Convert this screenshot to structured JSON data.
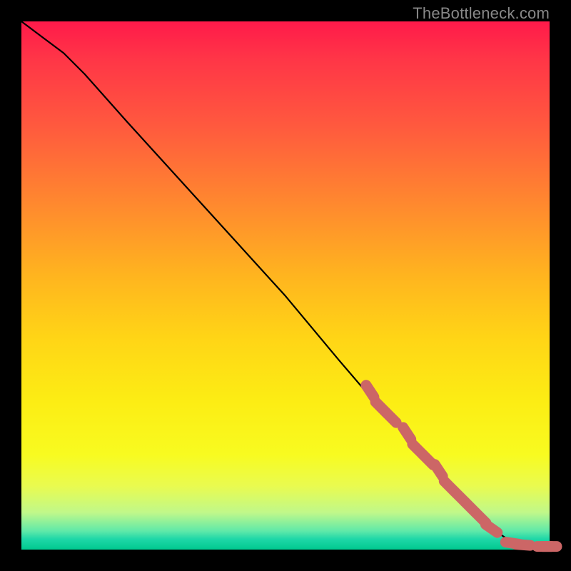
{
  "watermark": "TheBottleneck.com",
  "chart_data": {
    "type": "line",
    "title": "",
    "xlabel": "",
    "ylabel": "",
    "xlim": [
      0,
      100
    ],
    "ylim": [
      0,
      100
    ],
    "grid": false,
    "legend": false,
    "series": [
      {
        "name": "curve",
        "style": "line",
        "color": "#000000",
        "x": [
          0,
          4,
          8,
          12,
          20,
          30,
          40,
          50,
          60,
          66,
          70,
          74,
          78,
          82,
          86,
          89,
          92,
          94,
          96,
          98,
          100
        ],
        "y": [
          100,
          97,
          94,
          90,
          81,
          70,
          59,
          48,
          36,
          29,
          25,
          20,
          16,
          11,
          7,
          4,
          2,
          1,
          0.7,
          0.5,
          0.5
        ]
      },
      {
        "name": "points",
        "style": "scatter",
        "color": "#cc6666",
        "x": [
          66,
          68,
          70,
          73,
          75,
          77,
          79,
          81,
          83,
          85,
          87,
          89,
          93,
          95,
          99,
          100
        ],
        "y": [
          30,
          27,
          25,
          22,
          19,
          17,
          15,
          12,
          10,
          8,
          6,
          4,
          1.2,
          0.9,
          0.6,
          0.6
        ]
      }
    ]
  }
}
